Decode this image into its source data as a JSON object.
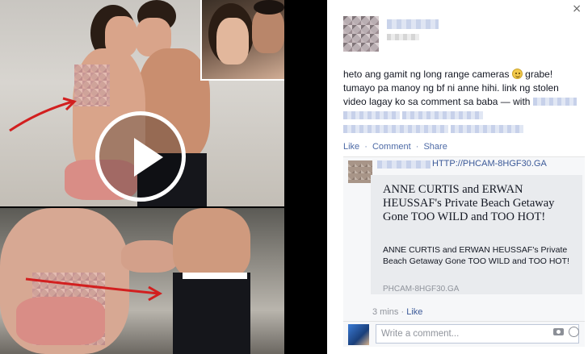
{
  "window": {
    "close_glyph": "×"
  },
  "media": {
    "play_icon": "play-icon",
    "photos": [
      "beach-couple-photo",
      "portrait-inset-photo",
      "beach-waist-photo"
    ]
  },
  "post": {
    "line1": "heto ang gamit ng long range cameras",
    "line2": "grabe!",
    "line3": "tumayo pa manoy ng bf ni anne hihi. link ng stolen video lagay ko sa comment sa baba —",
    "with_label": "with",
    "actions": {
      "like": "Like",
      "comment": "Comment",
      "share": "Share",
      "separator": "·"
    }
  },
  "comment": {
    "link_text": "HTTP://PHCAM-8HGF30.GA",
    "preview_title": "ANNE CURTIS and ERWAN HEUSSAF's Private Beach Getaway Gone TOO WILD and TOO HOT!",
    "preview_desc": "ANNE CURTIS and ERWAN HEUSSAF's Private Beach Getaway Gone TOO WILD and TOO HOT!",
    "preview_domain": "PHCAM-8HGF30.GA",
    "time": "3 mins",
    "separator": "·",
    "like": "Like"
  },
  "composer": {
    "placeholder": "Write a comment..."
  }
}
